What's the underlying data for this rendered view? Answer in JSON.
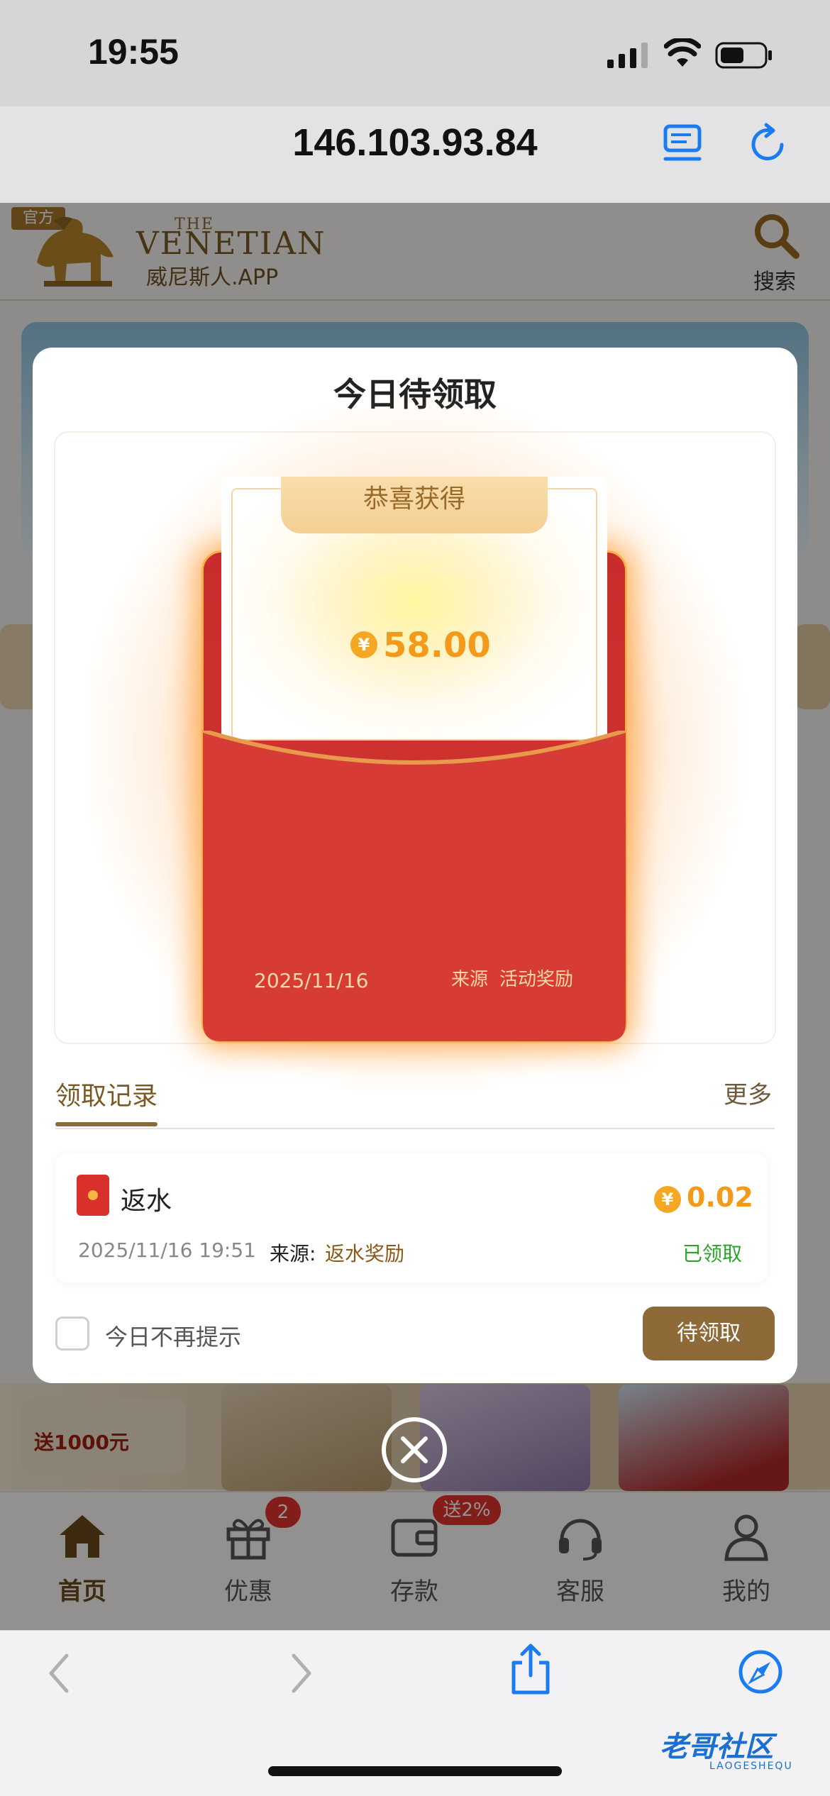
{
  "status_bar": {
    "time": "19:55"
  },
  "browser": {
    "url": "146.103.93.84"
  },
  "site_header": {
    "official_tag": "官方",
    "brand_the": "THE",
    "brand_name": "VENETIAN",
    "brand_app": "威尼斯人.APP",
    "search_label": "搜索"
  },
  "background_promo": {
    "left_text": "送1000元"
  },
  "modal": {
    "title": "今日待领取",
    "envelope": {
      "banner": "恭喜获得",
      "currency_symbol": "¥",
      "amount": "58.00",
      "date": "2025/11/16",
      "source_label": "来源",
      "source": "活动奖励"
    },
    "records": {
      "title": "领取记录",
      "more": "更多",
      "items": [
        {
          "name": "返水",
          "currency_symbol": "¥",
          "amount": "0.02",
          "time": "2025/11/16 19:51",
          "source_label": "来源:",
          "source": "返水奖励",
          "status": "已领取"
        }
      ]
    },
    "footer": {
      "dont_remind": "今日不再提示",
      "claim_button": "待领取"
    }
  },
  "bottom_nav": {
    "items": [
      {
        "label": "首页",
        "icon": "home-icon"
      },
      {
        "label": "优惠",
        "icon": "gift-icon"
      },
      {
        "label": "存款",
        "icon": "wallet-icon"
      },
      {
        "label": "客服",
        "icon": "headset-icon"
      },
      {
        "label": "我的",
        "icon": "user-icon"
      }
    ],
    "promo_badge": "2",
    "deposit_badge": "送2%"
  },
  "watermark": {
    "text": "老哥社区",
    "sub": "LAOGESHEQU"
  },
  "colors": {
    "accent": "#8d6a37",
    "red": "#d63a34",
    "gold": "#f39a1a",
    "success": "#2aa52a"
  }
}
